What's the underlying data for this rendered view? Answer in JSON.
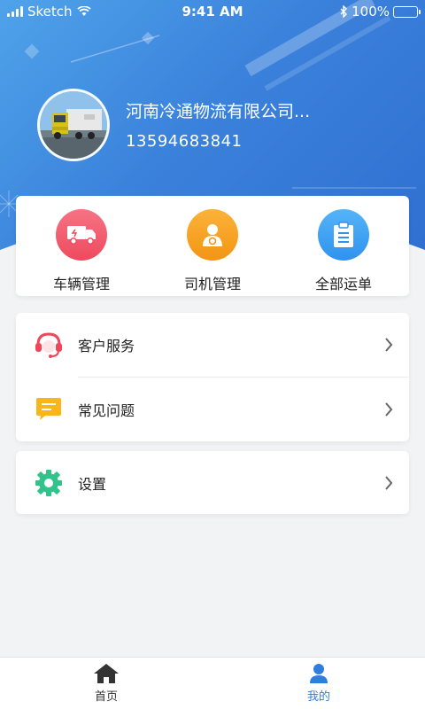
{
  "status_bar": {
    "carrier": "Sketch",
    "time": "9:41 AM",
    "battery": "100%"
  },
  "profile": {
    "company": "河南冷通物流有限公司...",
    "phone": "13594683841"
  },
  "quick_actions": [
    {
      "label": "车辆管理",
      "icon": "truck-icon",
      "color": "#f0586a"
    },
    {
      "label": "司机管理",
      "icon": "driver-icon",
      "color": "#f7a21e"
    },
    {
      "label": "全部运单",
      "icon": "clipboard-icon",
      "color": "#3aa0f2"
    }
  ],
  "menu": {
    "customer_service": "客户服务",
    "faq": "常见问题",
    "settings": "设置"
  },
  "tabbar": {
    "home": "首页",
    "mine": "我的"
  },
  "colors": {
    "header": "#3b82dc",
    "active_tab": "#2f7de1",
    "inactive_tab": "#333333"
  }
}
